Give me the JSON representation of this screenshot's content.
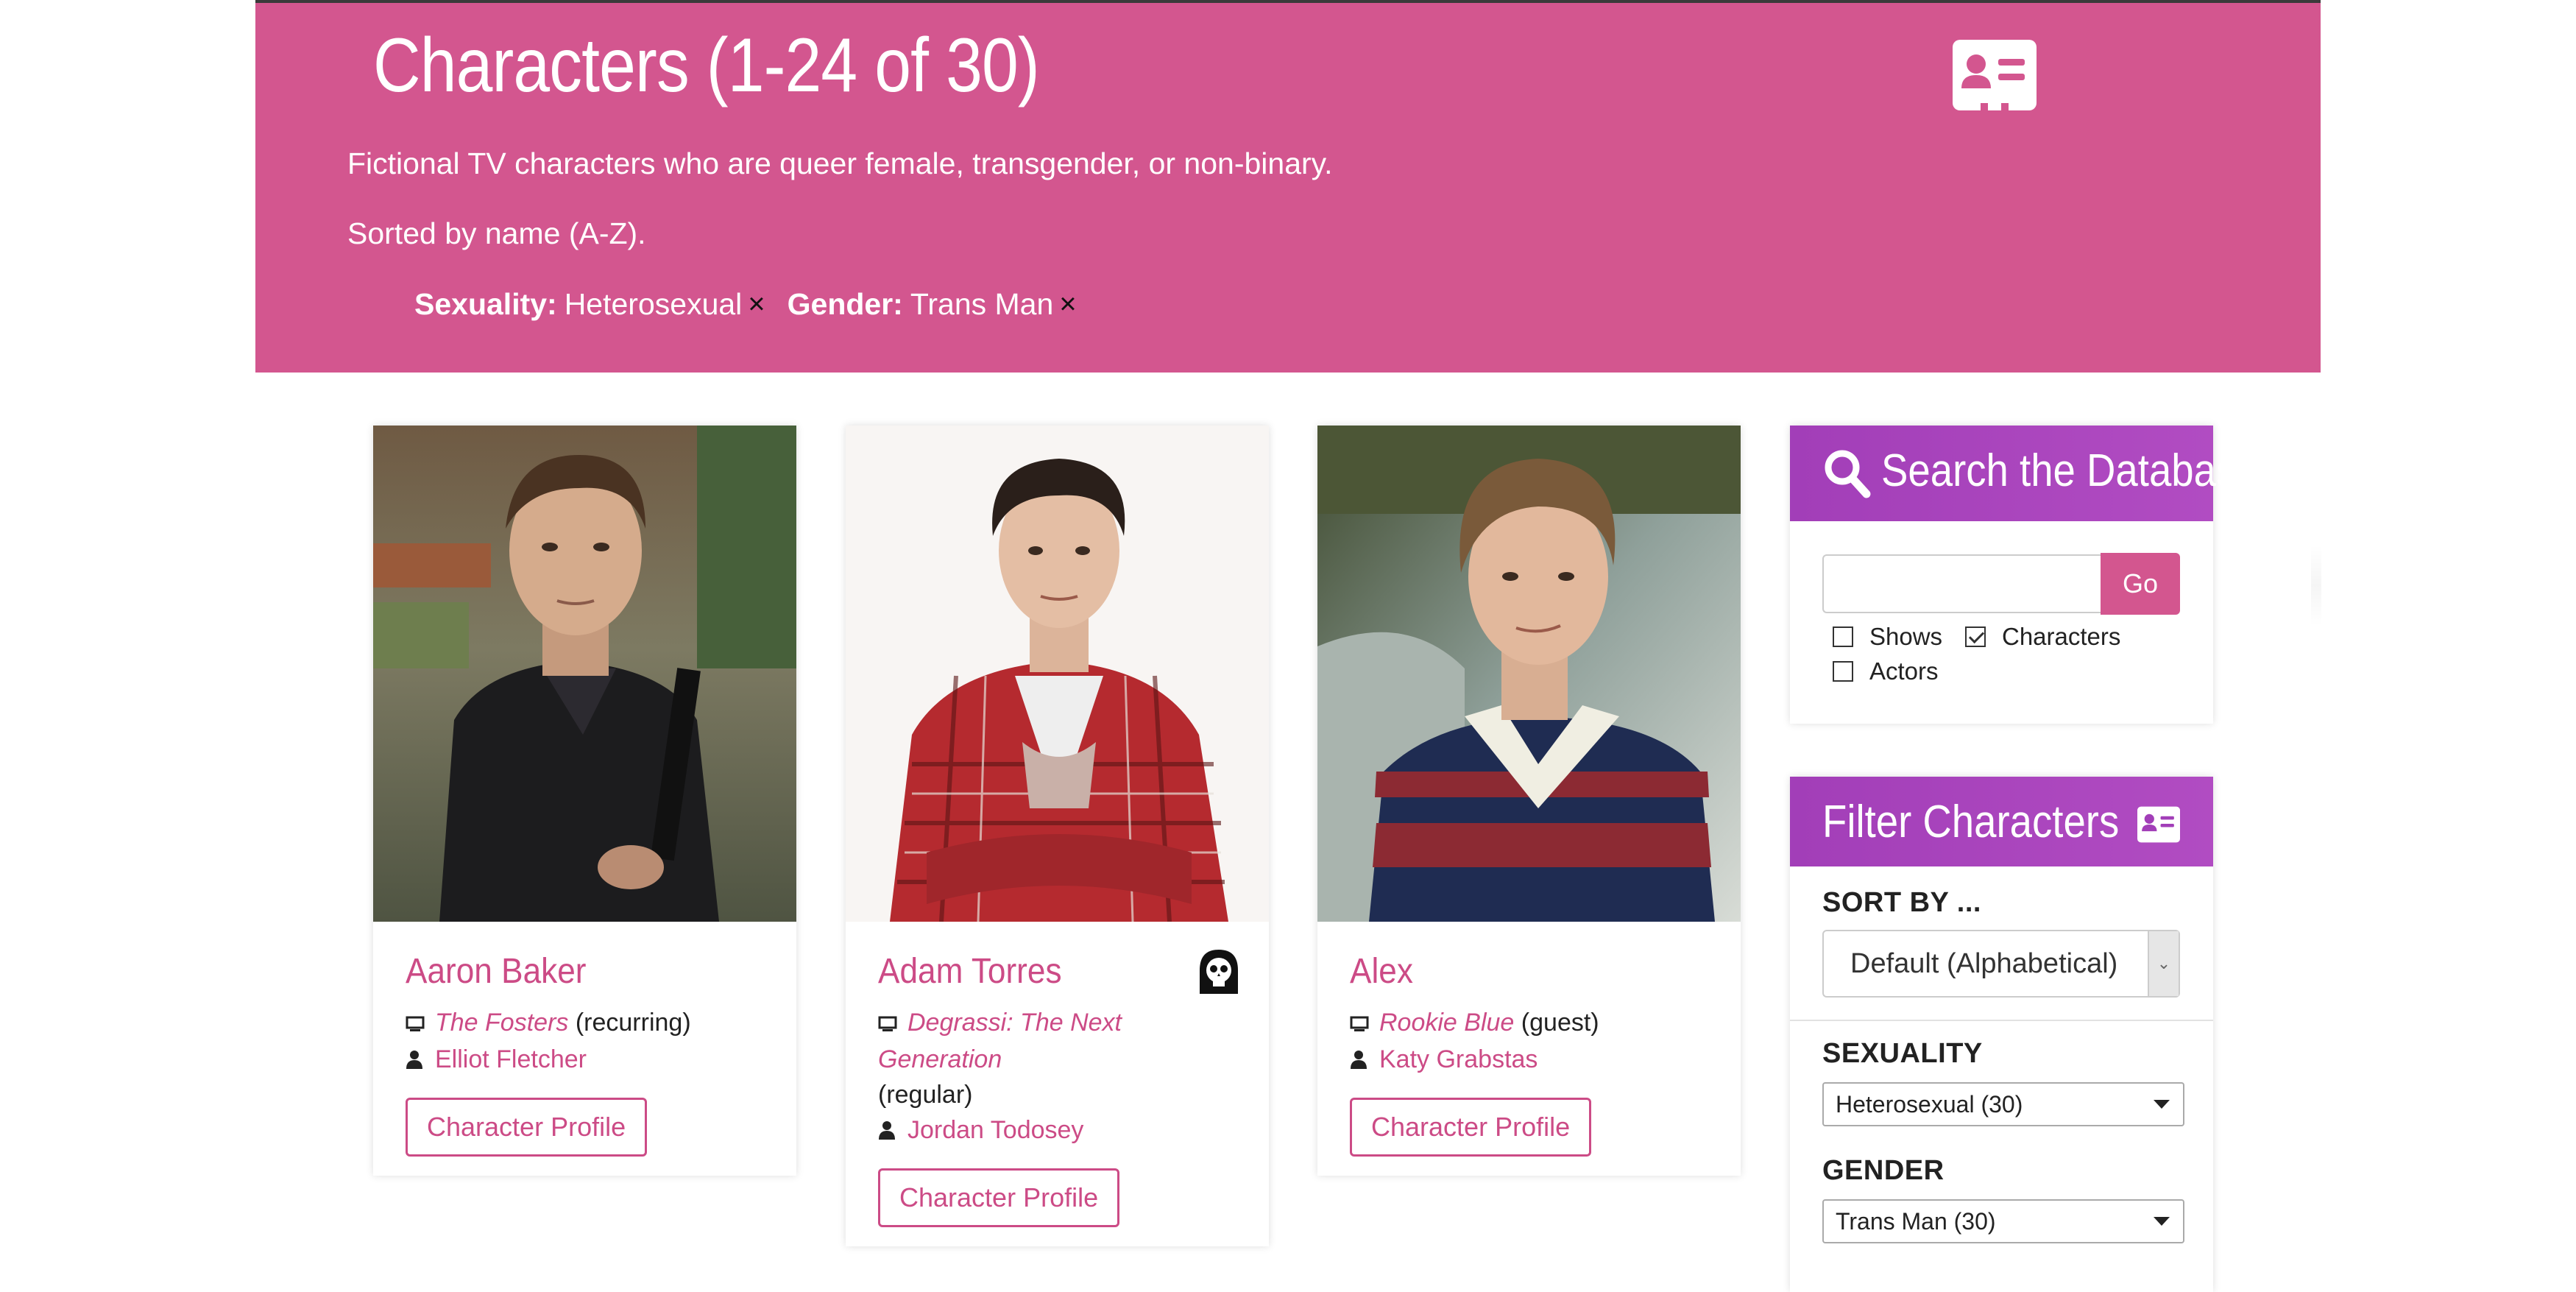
{
  "header": {
    "title": "Characters (1-24 of 30)",
    "description": "Fictional TV characters who are queer female, transgender, or non-binary.",
    "sorted": "Sorted by name (A-Z).",
    "active_filters": [
      {
        "key": "Sexuality:",
        "value": "Heterosexual",
        "remove": "×"
      },
      {
        "key": "Gender:",
        "value": "Trans Man",
        "remove": "×"
      }
    ],
    "icon": "id-card-icon"
  },
  "cards": [
    {
      "name": "Aaron Baker",
      "show": "The Fosters",
      "role": "(recurring)",
      "actor": "Elliot Fletcher",
      "button": "Character Profile",
      "dead": false
    },
    {
      "name": "Adam Torres",
      "show": "Degrassi: The Next Generation",
      "role": "(regular)",
      "actor": "Jordan Todosey",
      "button": "Character Profile",
      "dead": true
    },
    {
      "name": "Alex",
      "show": "Rookie Blue",
      "role": "(guest)",
      "actor": "Katy Grabstas",
      "button": "Character Profile",
      "dead": false
    }
  ],
  "search_panel": {
    "title": "Search the Database",
    "input_value": "",
    "go": "Go",
    "options": [
      {
        "label": "Shows",
        "checked": false
      },
      {
        "label": "Characters",
        "checked": true
      },
      {
        "label": "Actors",
        "checked": false
      }
    ]
  },
  "filter_panel": {
    "title": "Filter Characters",
    "sort_label": "SORT BY ...",
    "sort_value": "Default (Alphabetical)",
    "sexuality_label": "SEXUALITY",
    "sexuality_value": "Heterosexual (30)",
    "gender_label": "GENDER",
    "gender_value": "Trans Man (30)"
  },
  "colors": {
    "brand_pink": "#d3568f",
    "link_pink": "#cc4b86",
    "panel_purple": "#a23eb8"
  }
}
